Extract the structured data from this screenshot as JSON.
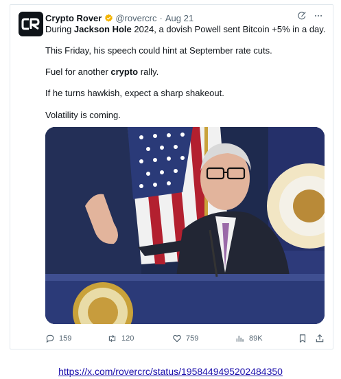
{
  "tweet": {
    "author_name": "Crypto Rover",
    "handle": "@rovercrc",
    "separator": "·",
    "date": "Aug 21",
    "lines": {
      "l1_pre": "During ",
      "l1_bold": "Jackson Hole",
      "l1_post": " 2024, a dovish Powell sent Bitcoin +5% in a day.",
      "l2": "This Friday, his speech could hint at September rate cuts.",
      "l3_pre": "Fuel for another ",
      "l3_bold": "crypto",
      "l3_post": " rally.",
      "l4": "If he turns hawkish, expect a sharp shakeout.",
      "l5": "Volatility is coming."
    },
    "metrics": {
      "replies": "159",
      "reposts": "120",
      "likes": "759",
      "views": "89K"
    }
  },
  "icons": {
    "avatar": "crypto-rover-logo",
    "verified": "verified-badge-icon",
    "grok": "grok-icon",
    "more": "more-icon",
    "reply": "reply-icon",
    "repost": "repost-icon",
    "like": "like-icon",
    "views": "views-icon",
    "bookmark": "bookmark-icon",
    "share": "share-icon"
  },
  "colors": {
    "verified": "#f4b400",
    "secondary_text": "#536471",
    "link": "#1a0dab"
  },
  "source_link": "https://x.com/rovercrc/status/1958449495202484350"
}
